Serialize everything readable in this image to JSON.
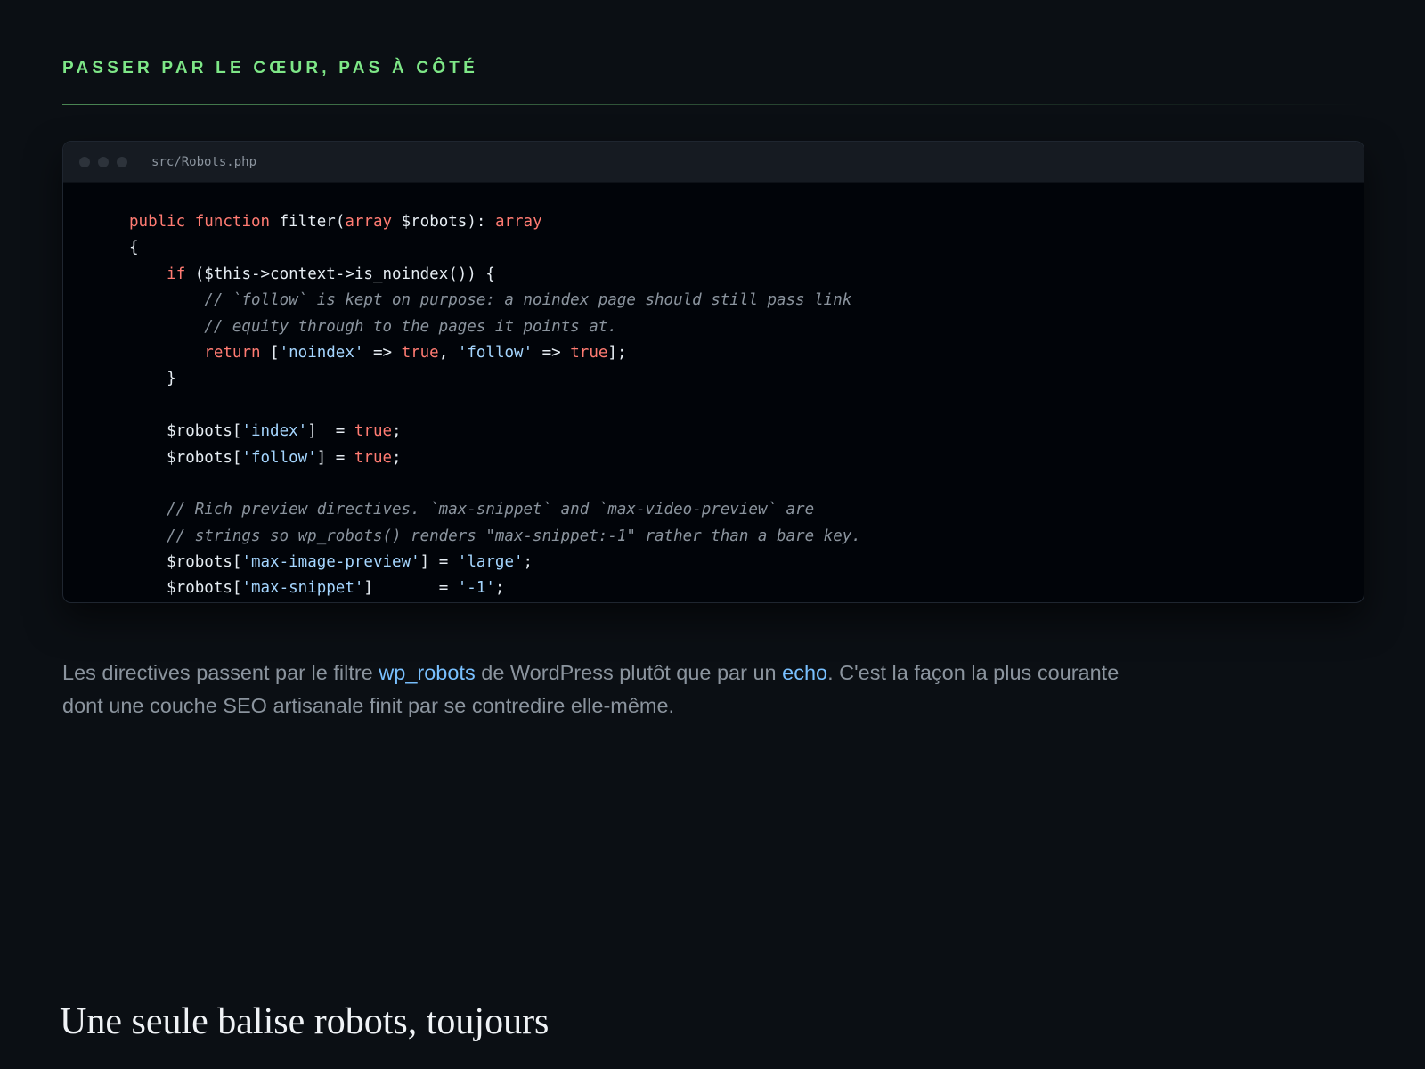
{
  "section": {
    "eyebrow": "PASSER PAR LE CŒUR, PAS À CÔTÉ"
  },
  "code_block": {
    "filename": "src/Robots.php",
    "tokens": {
      "public": "public",
      "function": "function",
      "array": "array",
      "if": "if",
      "return": "return",
      "true": "true"
    },
    "lines": {
      "l1_name": " filter(",
      "l1_param": " $robots): ",
      "l2": "{",
      "l3_indent": "    ",
      "l3_rest": " ($this->context->is_noindex()) {",
      "l4": "        // `follow` is kept on purpose: a noindex page should still pass link",
      "l5": "        // equity through to the pages it points at.",
      "l6_indent": "        ",
      "l6_open": " [",
      "l6_s1": "'noindex'",
      "l6_arrow1": " => ",
      "l6_sep": ", ",
      "l6_s2": "'follow'",
      "l6_arrow2": " => ",
      "l6_close": "];",
      "l7": "    }",
      "l9_pre": "    $robots[",
      "l9_key": "'index'",
      "l9_mid": "]  = ",
      "l9_end": ";",
      "l10_pre": "    $robots[",
      "l10_key": "'follow'",
      "l10_mid": "] = ",
      "l10_end": ";",
      "l12": "    // Rich preview directives. `max-snippet` and `max-video-preview` are",
      "l13": "    // strings so wp_robots() renders \"max-snippet:-1\" rather than a bare key.",
      "l14_pre": "    $robots[",
      "l14_key": "'max-image-preview'",
      "l14_mid": "] = ",
      "l14_val": "'large'",
      "l14_end": ";",
      "l15_pre": "    $robots[",
      "l15_key": "'max-snippet'",
      "l15_mid": "]       = ",
      "l15_val": "'-1'",
      "l15_end": ";"
    }
  },
  "prose": {
    "p1_a": "Les directives passent par le filtre ",
    "link1": "wp_robots",
    "p1_b": " de WordPress plutôt que par un ",
    "link2": "echo",
    "p1_c": ". C'est la façon la plus courante dont une couche SEO artisanale finit par se contredire elle-même."
  },
  "next_section": {
    "title": "Une seule balise robots, toujours"
  },
  "colors": {
    "background": "#0b0f14",
    "accent_green": "#7ee787",
    "keyword": "#ff7b72",
    "string": "#a5d6ff",
    "link": "#79c0ff",
    "comment": "#8b949e"
  }
}
